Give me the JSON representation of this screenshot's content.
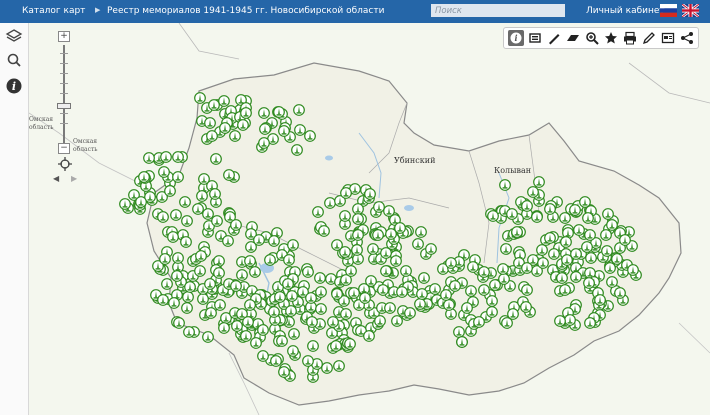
{
  "header": {
    "catalog_label": "Каталог карт",
    "breadcrumb": "Реестр мемориалов 1941-1945 гг. Новосибирской области",
    "search_placeholder": "Поиск",
    "cabinet_label": "Личный кабинет"
  },
  "left_sidebar": {
    "icons": [
      "layers-icon",
      "search-icon",
      "info-icon"
    ]
  },
  "map_tools": [
    "info-icon",
    "legend-icon",
    "draw-line-icon",
    "draw-polygon-icon",
    "zoom-area-icon",
    "bookmark-star-icon",
    "print-icon",
    "edit-pencil-icon",
    "layout-icon",
    "share-icon"
  ],
  "map_labels": {
    "district_ubinsky": "Убинский",
    "district_kolyvan": "Колыван",
    "left_edge_label": "Омская\nобласть",
    "left_edge_label_2": "Омская\nобласть"
  },
  "colors": {
    "header_bg": "#2566a8",
    "marker_green": "#2f8a1f",
    "region_fill": "#f1f1e6",
    "border": "#8a8a8a"
  }
}
